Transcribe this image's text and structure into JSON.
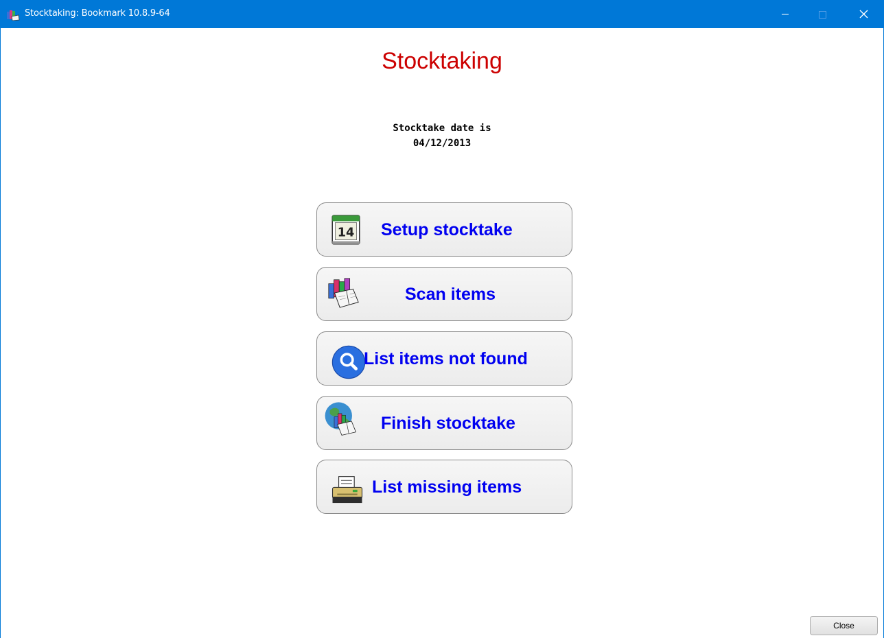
{
  "window": {
    "title": "Stocktaking: Bookmark 10.8.9-64",
    "app_icon": "books-icon",
    "controls": [
      "minimize-icon",
      "maximize-icon",
      "close-icon"
    ]
  },
  "main": {
    "heading": "Stocktaking",
    "date_caption": "Stocktake date is",
    "date_value": "04/12/2013",
    "buttons": [
      {
        "label": "Setup stocktake",
        "icon": "calendar-icon"
      },
      {
        "label": "Scan items",
        "icon": "books-icon"
      },
      {
        "label": "List items not found",
        "icon": "search-icon"
      },
      {
        "label": "Finish stocktake",
        "icon": "globe-books-icon"
      },
      {
        "label": "List missing items",
        "icon": "printer-icon"
      }
    ],
    "calendar_day": "14"
  },
  "footer": {
    "close_label": "Close"
  },
  "colors": {
    "titlebar": "#0078d7",
    "heading": "#cc0000",
    "button_text": "#0000f0"
  }
}
